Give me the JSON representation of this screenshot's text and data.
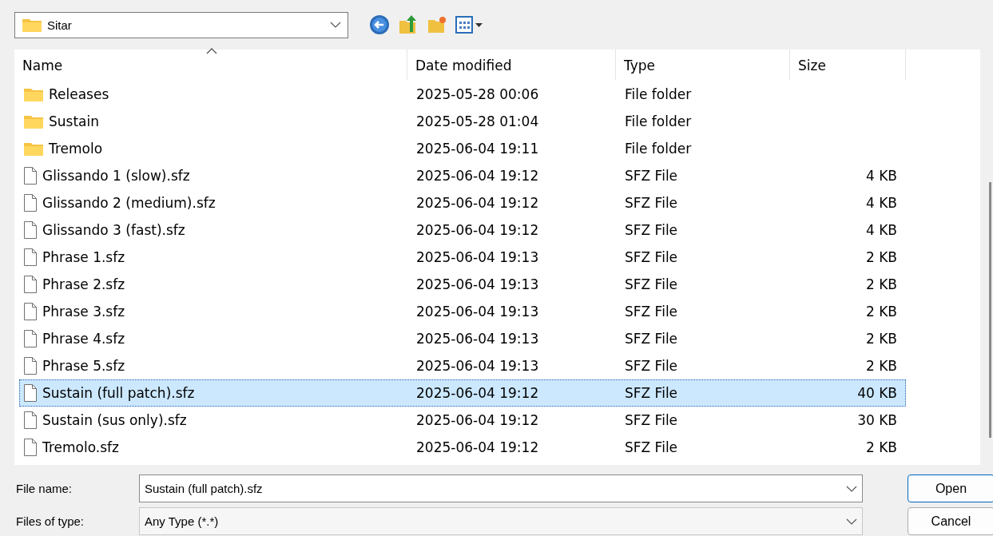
{
  "location": {
    "value": "Sitar"
  },
  "columns": [
    {
      "label": "Name",
      "sorted": true
    },
    {
      "label": "Date modified",
      "sorted": false
    },
    {
      "label": "Type",
      "sorted": false
    },
    {
      "label": "Size",
      "sorted": false
    }
  ],
  "rows": [
    {
      "kind": "folder",
      "name": "Releases",
      "date": "2025-05-28 00:06",
      "type": "File folder",
      "selected": false
    },
    {
      "kind": "folder",
      "name": "Sustain",
      "date": "2025-05-28 01:04",
      "type": "File folder",
      "selected": false
    },
    {
      "kind": "folder",
      "name": "Tremolo",
      "date": "2025-06-04 19:11",
      "type": "File folder",
      "selected": false
    },
    {
      "kind": "file",
      "name": "Glissando 1 (slow).sfz",
      "date": "2025-06-04 19:12",
      "type": "SFZ File",
      "size": "4 KB",
      "selected": false
    },
    {
      "kind": "file",
      "name": "Glissando 2 (medium).sfz",
      "date": "2025-06-04 19:12",
      "type": "SFZ File",
      "size": "4 KB",
      "selected": false
    },
    {
      "kind": "file",
      "name": "Glissando 3 (fast).sfz",
      "date": "2025-06-04 19:12",
      "type": "SFZ File",
      "size": "4 KB",
      "selected": false
    },
    {
      "kind": "file",
      "name": "Phrase 1.sfz",
      "date": "2025-06-04 19:13",
      "type": "SFZ File",
      "size": "2 KB",
      "selected": false
    },
    {
      "kind": "file",
      "name": "Phrase 2.sfz",
      "date": "2025-06-04 19:13",
      "type": "SFZ File",
      "size": "2 KB",
      "selected": false
    },
    {
      "kind": "file",
      "name": "Phrase 3.sfz",
      "date": "2025-06-04 19:13",
      "type": "SFZ File",
      "size": "2 KB",
      "selected": false
    },
    {
      "kind": "file",
      "name": "Phrase 4.sfz",
      "date": "2025-06-04 19:13",
      "type": "SFZ File",
      "size": "2 KB",
      "selected": false
    },
    {
      "kind": "file",
      "name": "Phrase 5.sfz",
      "date": "2025-06-04 19:13",
      "type": "SFZ File",
      "size": "2 KB",
      "selected": false
    },
    {
      "kind": "file",
      "name": "Sustain (full patch).sfz",
      "date": "2025-06-04 19:12",
      "type": "SFZ File",
      "size": "40 KB",
      "selected": true
    },
    {
      "kind": "file",
      "name": "Sustain (sus only).sfz",
      "date": "2025-06-04 19:12",
      "type": "SFZ File",
      "size": "30 KB",
      "selected": false
    },
    {
      "kind": "file",
      "name": "Tremolo.sfz",
      "date": "2025-06-04 19:12",
      "type": "SFZ File",
      "size": "2 KB",
      "selected": false
    }
  ],
  "file_name": {
    "label": "File name:",
    "value": "Sustain (full patch).sfz"
  },
  "file_type": {
    "label": "Files of type:",
    "value": "Any Type (*.*)"
  },
  "buttons": [
    "Open",
    "Cancel"
  ]
}
